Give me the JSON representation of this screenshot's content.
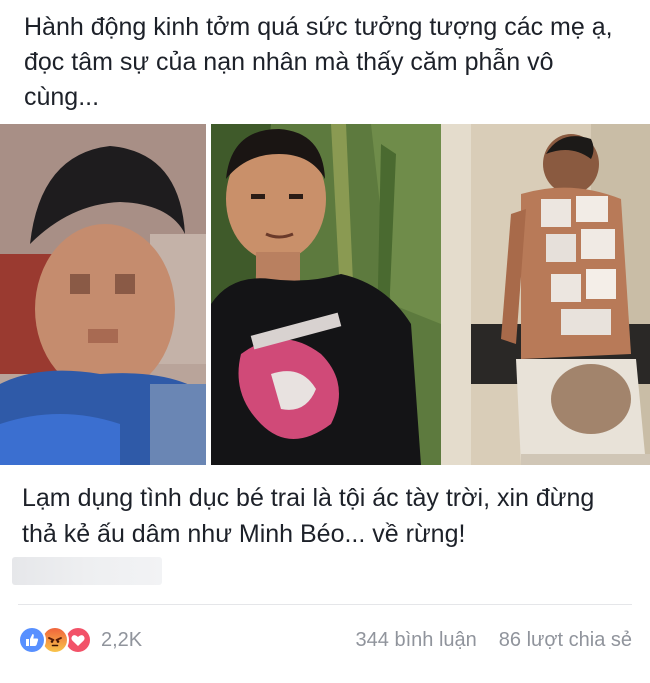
{
  "post": {
    "text": "Hành động kinh tởm quá sức tưởng tượng các mẹ ạ, đọc tâm sự của nạn nhân mà thấy căm phẫn vô cùng..."
  },
  "link": {
    "title": "Lạm dụng tình dục bé trai là tội ác tày trời, xin đừng thả kẻ ấu dâm như Minh Béo... về rừng!"
  },
  "footer": {
    "reaction_icons": [
      "like-icon",
      "angry-icon",
      "love-icon"
    ],
    "reaction_count": "2,2K",
    "comments": "344 bình luận",
    "shares": "86 lượt chia sẻ"
  },
  "colors": {
    "like": "#5890ff",
    "love": "#f25268",
    "angry_top": "#f0643c",
    "angry_bottom": "#f8c44a",
    "meta_text": "#90949c",
    "body_text": "#1d2129"
  }
}
